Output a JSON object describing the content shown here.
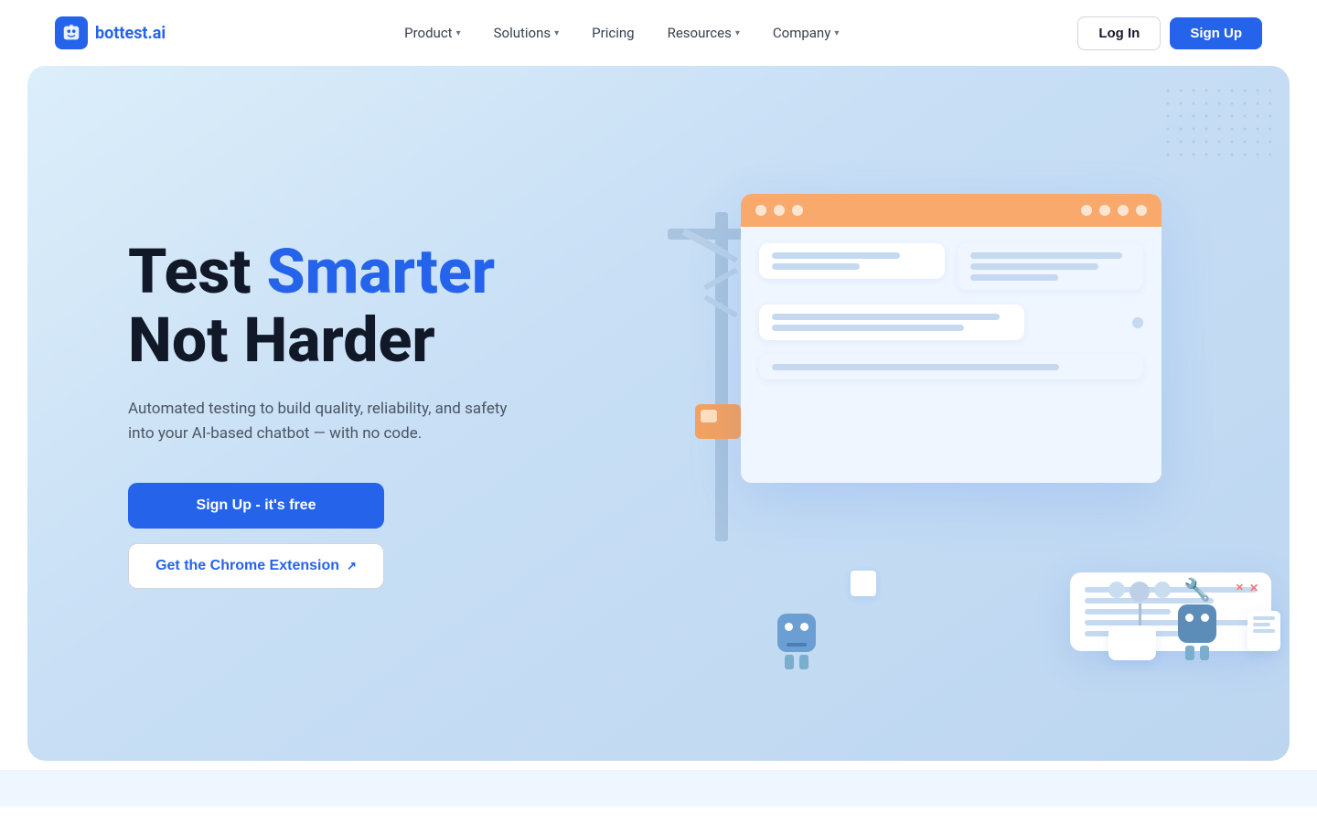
{
  "nav": {
    "logo_text": "bottest",
    "logo_suffix": ".ai",
    "links": [
      {
        "label": "Product",
        "has_dropdown": true
      },
      {
        "label": "Solutions",
        "has_dropdown": true
      },
      {
        "label": "Pricing",
        "has_dropdown": false
      },
      {
        "label": "Resources",
        "has_dropdown": true
      },
      {
        "label": "Company",
        "has_dropdown": true
      }
    ],
    "login_label": "Log In",
    "signup_label": "Sign Up"
  },
  "hero": {
    "title_part1": "Test ",
    "title_accent": "Smarter",
    "title_part2": "Not Harder",
    "subtitle": "Automated testing to build quality, reliability, and safety into your AI-based chatbot — with no code.",
    "cta_primary": "Sign Up - it's free",
    "cta_secondary": "Get the Chrome Extension",
    "ext_arrow": "↗"
  }
}
